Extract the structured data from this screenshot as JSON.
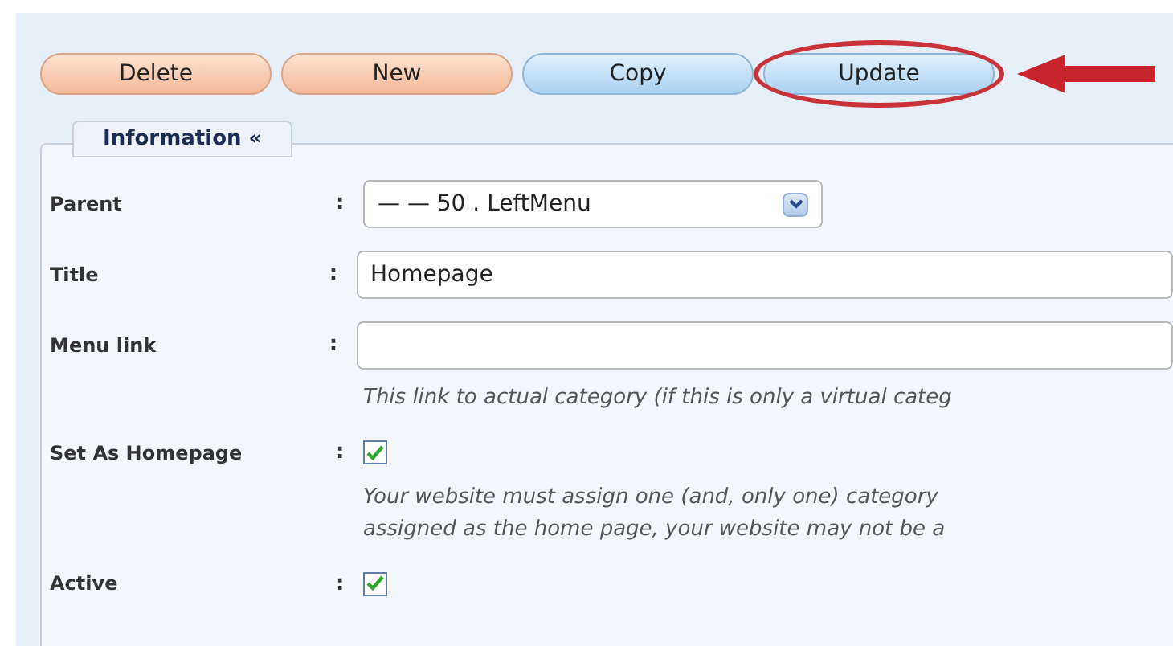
{
  "buttons": [
    {
      "label": "Delete",
      "kind": "orange"
    },
    {
      "label": "New",
      "kind": "orange"
    },
    {
      "label": "Copy",
      "kind": "blue",
      "highlighted": false
    },
    {
      "label": "Update",
      "kind": "blue",
      "highlighted": true
    }
  ],
  "tab": {
    "label": "Information «"
  },
  "fields": [
    {
      "label": "Parent",
      "separator": ":",
      "kind": "select",
      "value": "— — 50 . LeftMenu"
    },
    {
      "label": "Title",
      "separator": ":",
      "kind": "text",
      "value": "Homepage"
    },
    {
      "label": "Menu link",
      "separator": ":",
      "kind": "text",
      "hint": [
        "This link to actual category (if this is only a virtual categ"
      ]
    },
    {
      "label": "Set As Homepage",
      "separator": ":",
      "kind": "checkbox",
      "checked": true,
      "hint": [
        "Your website must assign one (and, only one) category",
        "assigned as the home page, your website may not be a"
      ]
    },
    {
      "label": "Active",
      "separator": ":",
      "kind": "checkbox",
      "checked": true
    }
  ]
}
